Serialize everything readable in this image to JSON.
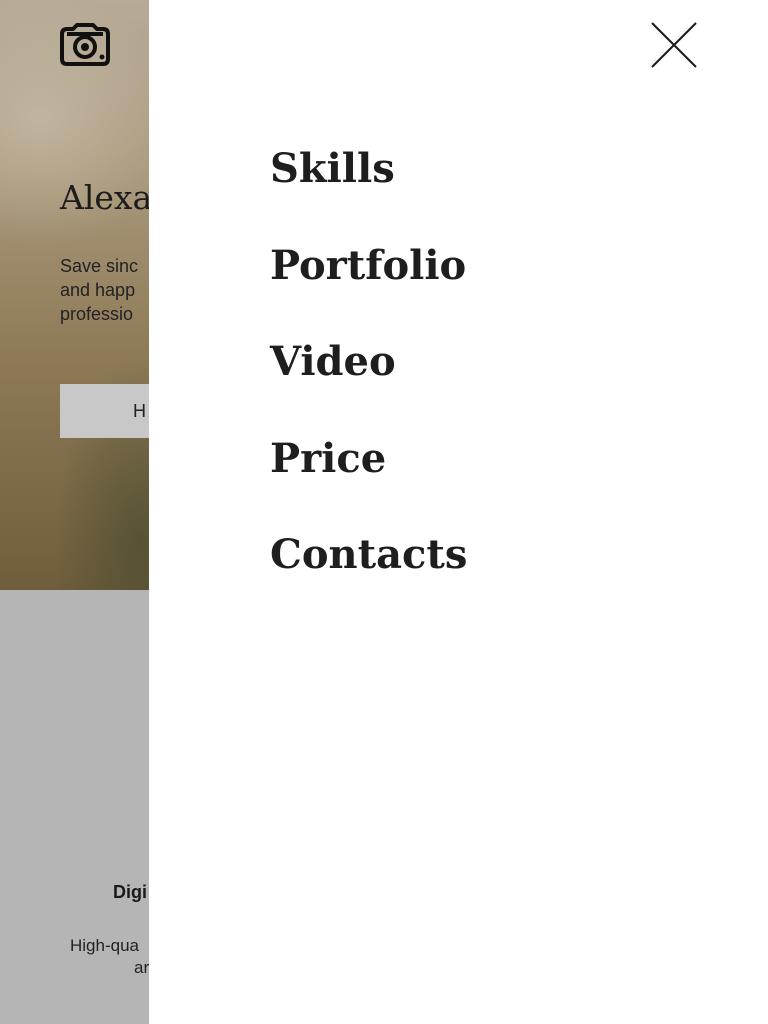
{
  "page": {
    "logo_icon": "camera-icon",
    "hero": {
      "title": "Alexa",
      "text_lines": [
        "Save sinc",
        "and happ",
        "professio"
      ],
      "button_label": "H"
    },
    "service": {
      "title": "Digi",
      "text_lines": [
        "High-qua",
        "ar"
      ]
    }
  },
  "menu": {
    "close_icon": "close-icon",
    "items": [
      {
        "label": "Skills"
      },
      {
        "label": "Portfolio"
      },
      {
        "label": "Video"
      },
      {
        "label": "Price"
      },
      {
        "label": "Contacts"
      }
    ]
  },
  "colors": {
    "menu_background": "#ffffff",
    "page_background": "#b5b5b5",
    "text": "#1e1e1e"
  }
}
